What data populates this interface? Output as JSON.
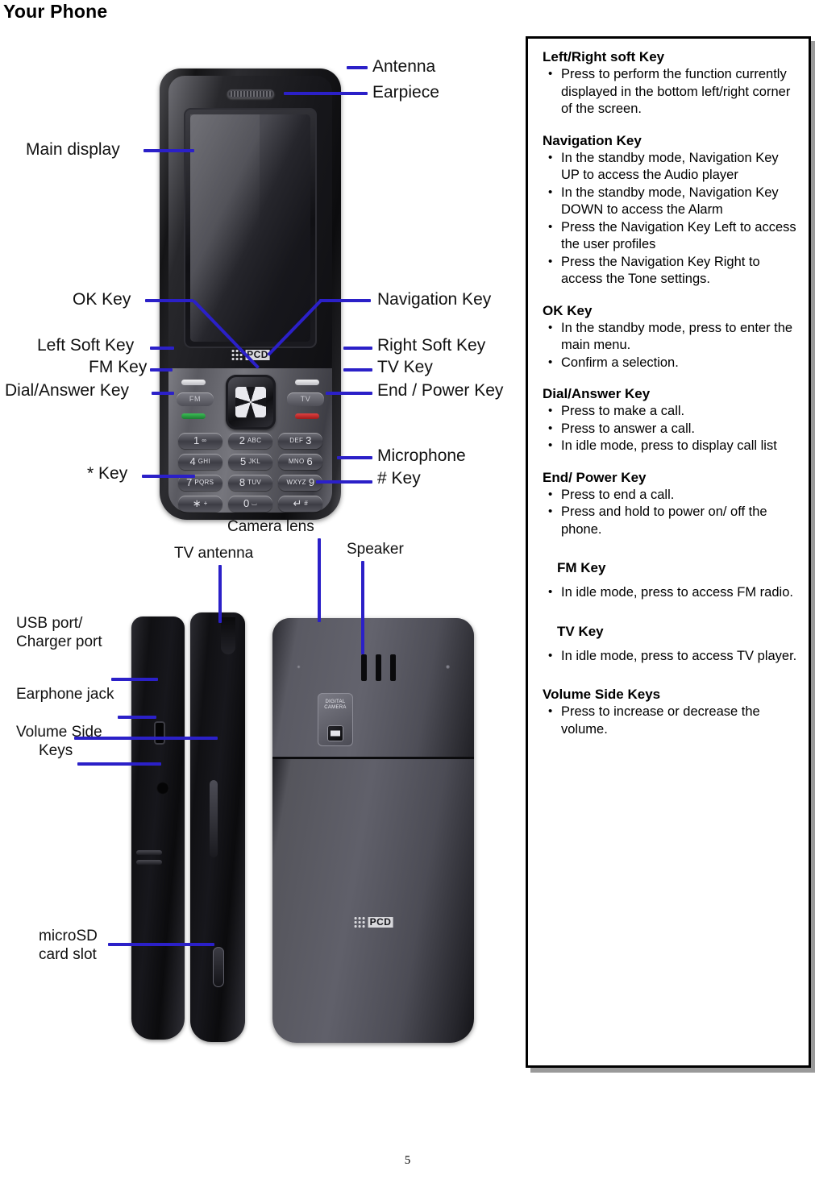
{
  "page": {
    "title": "Your Phone",
    "number": "5",
    "brand": "PCD",
    "accent_color": "#2b20c8"
  },
  "diagram": {
    "front_labels": [
      {
        "text": "Antenna"
      },
      {
        "text": "Earpiece"
      },
      {
        "text": "Main display"
      },
      {
        "text": "OK Key"
      },
      {
        "text": "Navigation Key"
      },
      {
        "text": "Left Soft Key"
      },
      {
        "text": "Right Soft Key"
      },
      {
        "text": "FM Key"
      },
      {
        "text": "TV Key"
      },
      {
        "text": "Dial/Answer  Key"
      },
      {
        "text": "End / Power Key"
      },
      {
        "text": "* Key"
      },
      {
        "text": "Microphone"
      },
      {
        "text": "# Key"
      }
    ],
    "back_labels": [
      {
        "text": "Camera lens"
      },
      {
        "text": "Speaker"
      },
      {
        "text": "TV antenna"
      },
      {
        "text": "USB port/"
      },
      {
        "text": "Charger port"
      },
      {
        "text": "Earphone jack"
      },
      {
        "text": "Volume Side"
      },
      {
        "text": "Keys"
      },
      {
        "text": "microSD"
      },
      {
        "text": "card slot"
      }
    ],
    "keypad": [
      {
        "big": "1",
        "sml": "∞"
      },
      {
        "big": "2",
        "sml": "ABC",
        "order": "big-first"
      },
      {
        "big": "3",
        "sml": "DEF",
        "order": "sml-first"
      },
      {
        "big": "4",
        "sml": "GHI",
        "order": "big-first"
      },
      {
        "big": "5",
        "sml": "JKL",
        "order": "big-first"
      },
      {
        "big": "6",
        "sml": "MNO",
        "order": "sml-first"
      },
      {
        "big": "7",
        "sml": "PQRS",
        "order": "big-first"
      },
      {
        "big": "8",
        "sml": "TUV",
        "order": "big-first"
      },
      {
        "big": "9",
        "sml": "WXYZ",
        "order": "sml-first"
      },
      {
        "big": "∗",
        "sml": "+",
        "order": "big-first"
      },
      {
        "big": "0",
        "sml": "⌴",
        "order": "big-first"
      },
      {
        "big": "↵",
        "sml": "#",
        "order": "big-first"
      }
    ],
    "function_keys": {
      "fm": "FM",
      "tv": "TV"
    },
    "camera_plate": {
      "line1": "DIGITAL",
      "line2": "CAMERA"
    }
  },
  "info_panel": {
    "sections": [
      {
        "heading": "Left/Right soft Key",
        "indent": false,
        "items": [
          "Press to perform the function currently displayed in the bottom left/right corner of the screen."
        ]
      },
      {
        "heading": "Navigation Key",
        "indent": false,
        "items": [
          "In the standby mode,  Navigation Key UP to access the Audio player",
          "In the standby mode,  Navigation Key DOWN to access the Alarm",
          "Press the Navigation Key Left to access the user profiles",
          "Press the Navigation Key Right to access the Tone settings."
        ]
      },
      {
        "heading": "OK Key",
        "indent": false,
        "items": [
          "In the standby mode, press to enter the main menu.",
          "Confirm a selection."
        ]
      },
      {
        "heading": "Dial/Answer Key",
        "indent": false,
        "items": [
          "Press to make a call.",
          "Press to answer a call.",
          "In idle mode, press to display call list"
        ]
      },
      {
        "heading": "End/ Power Key",
        "indent": false,
        "items": [
          "Press to end a call.",
          "Press and hold to power on/ off the phone."
        ]
      },
      {
        "heading": "FM Key",
        "indent": true,
        "items": [
          "In idle mode, press to access FM radio."
        ]
      },
      {
        "heading": "TV Key",
        "indent": true,
        "items": [
          "In idle mode, press to access TV player."
        ]
      },
      {
        "heading": "Volume Side Keys",
        "indent": false,
        "items": [
          "Press to increase or decrease the volume."
        ]
      }
    ]
  }
}
